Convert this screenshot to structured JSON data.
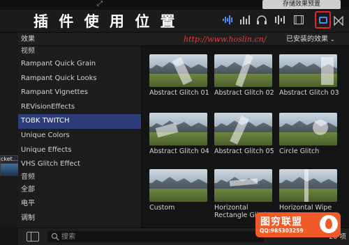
{
  "top": {
    "button_label": "存储效果预置"
  },
  "overlay_title": "插 件 使 用 位 置",
  "header": {
    "column_label": "效果",
    "url": "http://www.hoslin.cn/",
    "installed_label": "已安装的效果"
  },
  "sidebar_clip_label": "cket...",
  "categories": [
    {
      "label": "视频",
      "kind": "section"
    },
    {
      "label": "Rampant Quick Grain",
      "kind": "item"
    },
    {
      "label": "Rampant Quick Looks",
      "kind": "item"
    },
    {
      "label": "Rampant Vignettes",
      "kind": "item"
    },
    {
      "label": "REVisionEffects",
      "kind": "item"
    },
    {
      "label": "TOBK TWITCH",
      "kind": "item",
      "selected": true
    },
    {
      "label": "Unique Colors",
      "kind": "item"
    },
    {
      "label": "Unique Effects",
      "kind": "item"
    },
    {
      "label": "VHS Glitch Effect",
      "kind": "item"
    },
    {
      "label": "音频",
      "kind": "section"
    },
    {
      "label": "全部",
      "kind": "item"
    },
    {
      "label": "电平",
      "kind": "item"
    },
    {
      "label": "调制",
      "kind": "item"
    }
  ],
  "effects": [
    {
      "label": "Abstract Glitch 01"
    },
    {
      "label": "Abstract Glitch 02"
    },
    {
      "label": "Abstract Glitch 03"
    },
    {
      "label": "Abstract Glitch 04"
    },
    {
      "label": "Abstract Glitch 05"
    },
    {
      "label": "Circle Glitch"
    },
    {
      "label": "Custom"
    },
    {
      "label": "Horizontal Rectangle Glitch"
    },
    {
      "label": "Horizontal Wipe"
    }
  ],
  "bottom": {
    "search_placeholder": "搜索",
    "count": "20 项"
  },
  "watermark": {
    "title": "图穷联盟",
    "qq": "QQ:985303259"
  },
  "colors": {
    "selected": "#2d3d77",
    "url_red": "#e23b3b",
    "accent_blue": "#4d8ef0",
    "highlight_red": "#e2242b",
    "watermark_orange": "#ef5a28"
  }
}
